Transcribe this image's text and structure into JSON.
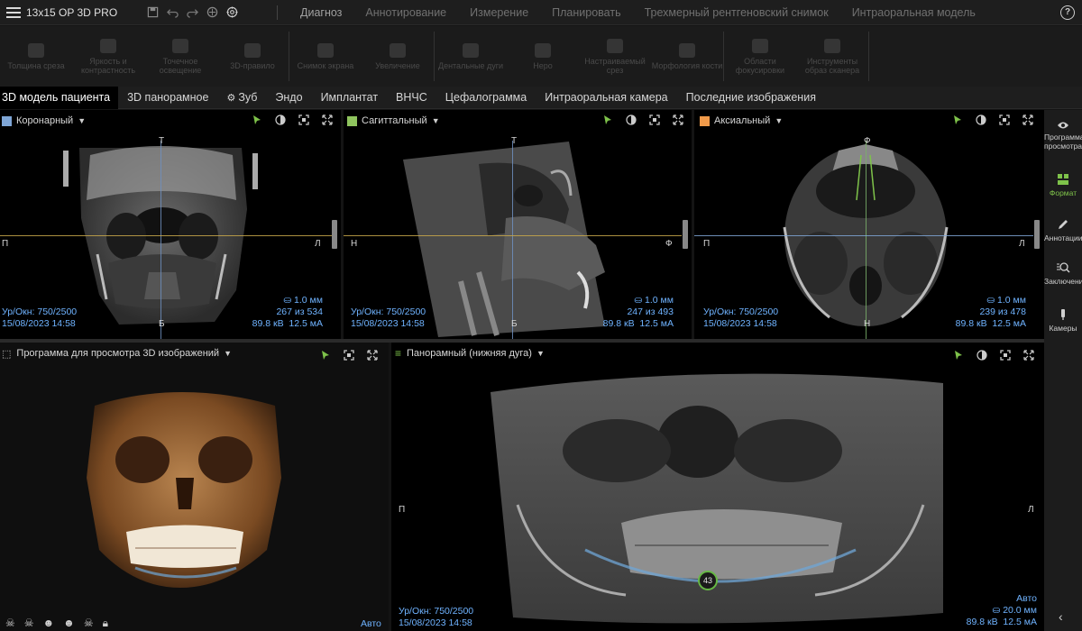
{
  "app": {
    "title": "13x15 OP 3D PRO"
  },
  "main_tabs": [
    "Диагноз",
    "Аннотирование",
    "Измерение",
    "Планировать",
    "Трехмерный рентгеновский снимок",
    "Интраоральная модель"
  ],
  "ribbon": {
    "tools": [
      "Толщина среза",
      "Яркость и контрастность",
      "Точечное освещение",
      "3D-правило",
      "Снимок экрана",
      "Увеличение",
      "Дентальные дуги",
      "Неро",
      "Настраиваемый срез",
      "Морфология кости",
      "Области фокусировки",
      "Инструменты образ сканера"
    ]
  },
  "sub_tabs": [
    {
      "label": "3D модель пациента",
      "icon": ""
    },
    {
      "label": "3D панорамное",
      "icon": ""
    },
    {
      "label": "Зуб",
      "icon": "tooth-icon"
    },
    {
      "label": "Эндо",
      "icon": ""
    },
    {
      "label": "Имплантат",
      "icon": ""
    },
    {
      "label": "ВНЧС",
      "icon": ""
    },
    {
      "label": "Цефалограмма",
      "icon": ""
    },
    {
      "label": "Интраоральная камера",
      "icon": ""
    },
    {
      "label": "Последние изображения",
      "icon": ""
    }
  ],
  "views": {
    "coronal": {
      "title": "Коронарный",
      "color": "#7fa6d6",
      "top": "Т",
      "bottom": "Б",
      "left": "П",
      "right": "Л",
      "window": "Ур/Окн: 750/2500",
      "date": "15/08/2023 14:58",
      "thickness": "1.0 мм",
      "slice": "267 из 534",
      "kv": "89.8 кВ",
      "ma": "12.5 мА"
    },
    "sagittal": {
      "title": "Сагиттальный",
      "color": "#8fc45e",
      "top": "Т",
      "bottom": "Б",
      "left": "Н",
      "right": "Ф",
      "window": "Ур/Окн: 750/2500",
      "date": "15/08/2023 14:58",
      "thickness": "1.0 мм",
      "slice": "247 из 493",
      "kv": "89.8 кВ",
      "ma": "12.5 мА"
    },
    "axial": {
      "title": "Аксиальный",
      "color": "#f09a4a",
      "top": "Ф",
      "bottom": "Н",
      "left": "П",
      "right": "Л",
      "window": "Ур/Окн: 750/2500",
      "date": "15/08/2023 14:58",
      "thickness": "1.0 мм",
      "slice": "239 из 478",
      "kv": "89.8 кВ",
      "ma": "12.5 мА"
    },
    "viewer3d": {
      "title": "Программа для просмотра 3D изображений",
      "auto": "Авто"
    },
    "panoramic": {
      "title": "Панорамный (нижняя дуга)",
      "left": "П",
      "right": "Л",
      "window": "Ур/Окн: 750/2500",
      "date": "15/08/2023 14:58",
      "auto": "Авто",
      "thickness": "20.0 мм",
      "kv": "89.8 кВ",
      "ma": "12.5 мА",
      "tooth": "43"
    }
  },
  "sidebar": [
    {
      "label": "Программа просмотра",
      "icon": "eye-icon"
    },
    {
      "label": "Формат",
      "icon": "layout-icon"
    },
    {
      "label": "Аннотации",
      "icon": "pen-icon"
    },
    {
      "label": "Заключения",
      "icon": "findings-icon"
    },
    {
      "label": "Камеры",
      "icon": "camera-icon"
    }
  ]
}
